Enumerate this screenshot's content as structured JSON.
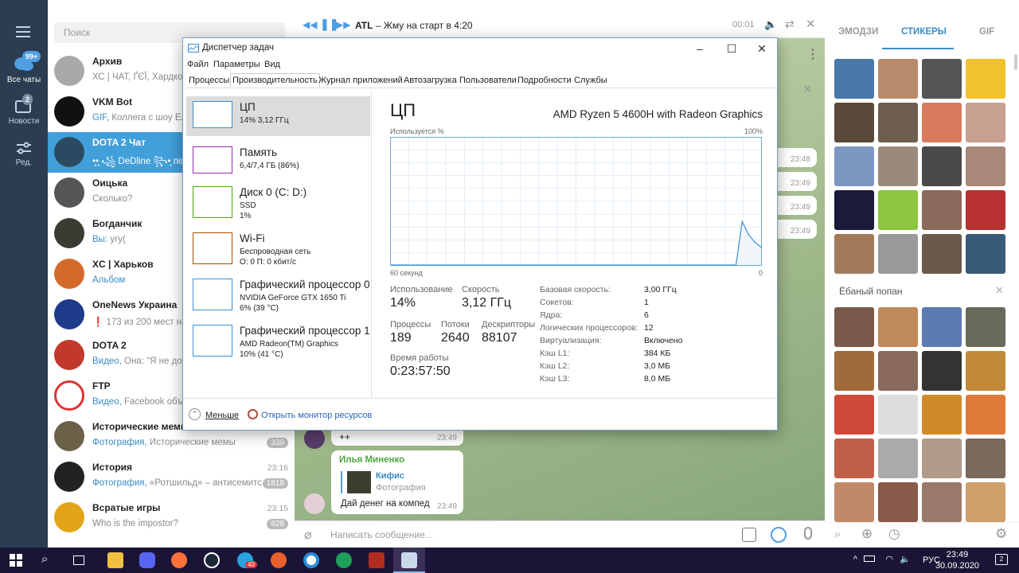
{
  "telegram": {
    "rail": [
      {
        "label": "Все чаты",
        "badge": "99+",
        "icon": "chat-bubbles-icon"
      },
      {
        "label": "Новости",
        "badge": "2",
        "icon": "folder-icon"
      },
      {
        "label": "Ред.",
        "badge": "",
        "icon": "sliders-icon"
      }
    ],
    "search_placeholder": "Поиск",
    "chats": [
      {
        "name": "Архив",
        "preview": "ХС | ЧАТ, ҐЄЇ, Хардкор...",
        "time": "",
        "badge": ""
      },
      {
        "name": "VKM Bot",
        "preview_prefix": "GIF,",
        "preview": "Коллега с шоу Еле...",
        "time": "",
        "badge": ""
      },
      {
        "name": "DOTA 2 Чат",
        "preview": "•̩̩̩͙͙•̩̩̩͙͙ ꧁ DeDline ꧂•̩̩̩͙͙ печ...",
        "time": "",
        "badge": ""
      },
      {
        "name": "Оицька",
        "preview": "Сколько?",
        "time": "",
        "badge": ""
      },
      {
        "name": "Богданчик",
        "preview_prefix": "Вы:",
        "preview": "угу(",
        "time": "",
        "badge": ""
      },
      {
        "name": "XC | Харьков",
        "preview_prefix": "Альбом",
        "preview": "",
        "time": "",
        "badge": ""
      },
      {
        "name": "OneNews Украина",
        "preview": "❗ 173 из 200 мест на...",
        "time": "",
        "badge": ""
      },
      {
        "name": "DOTA 2",
        "preview_prefix": "Видео,",
        "preview": "Она: \"Я не дого...",
        "time": "",
        "badge": ""
      },
      {
        "name": "FTP",
        "preview_prefix": "Видео,",
        "preview": "Facebook объе...",
        "time": "",
        "badge": ""
      },
      {
        "name": "Исторические мемы",
        "preview_prefix": "Фотография,",
        "preview": "Исторические мемы",
        "time": "",
        "badge": "339"
      },
      {
        "name": "История",
        "preview_prefix": "Фотография,",
        "preview": "«Ротшильд» – антисемитс...",
        "time": "23:16",
        "badge": "1818"
      },
      {
        "name": "Всратые игры",
        "preview": "Who is the impostor?",
        "time": "23:15",
        "badge": "628"
      }
    ],
    "player": {
      "artist": "ATL",
      "track": "– Жму на старт в 4:20",
      "time": "00:01"
    },
    "messages": {
      "times_right": [
        "23:48",
        "23:49",
        "23:49",
        "23:49"
      ],
      "plus": "++",
      "plus_time": "23:49",
      "sender": "Илья Миненко",
      "reply_name": "Кифис",
      "reply_type": "Фотография",
      "text": "Дай денег на компед",
      "text_time": "23:49"
    },
    "composer_placeholder": "Написать сообщение...",
    "sticker_tabs": [
      "ЭМОДЗИ",
      "СТИКЕРЫ",
      "GIF"
    ],
    "sticker_pack": "Ёбаный попан"
  },
  "taskmanager": {
    "title": "Диспетчер задач",
    "menu": [
      "Файл",
      "Параметры",
      "Вид"
    ],
    "tabs": [
      "Процессы",
      "Производительность",
      "Журнал приложений",
      "Автозагрузка",
      "Пользователи",
      "Подробности",
      "Службы"
    ],
    "resources": [
      {
        "name": "ЦП",
        "line1": "14%  3,12 ГГц",
        "line2": "",
        "color": "#3c8fd2"
      },
      {
        "name": "Память",
        "line1": "6,4/7,4 ГБ (86%)",
        "line2": "",
        "color": "#9528b4"
      },
      {
        "name": "Диск 0 (C: D:)",
        "line1": "SSD",
        "line2": "1%",
        "color": "#4da60c"
      },
      {
        "name": "Wi-Fi",
        "line1": "Беспроводная сеть",
        "line2": "О: 0  П: 0 кбит/с",
        "color": "#a74f01"
      },
      {
        "name": "Графический процессор 0",
        "line1": "NVIDIA GeForce GTX 1650 Ti",
        "line2": "6% (39 °C)",
        "color": "#3c8fd2"
      },
      {
        "name": "Графический процессор 1",
        "line1": "AMD Radeon(TM) Graphics",
        "line2": "10% (41 °C)",
        "color": "#3c8fd2"
      }
    ],
    "cpu": {
      "heading": "ЦП",
      "model": "AMD Ryzen 5 4600H with Radeon Graphics",
      "usage_caption": "Используется %",
      "max_caption": "100%",
      "axis_left": "60 секунд",
      "axis_right": "0",
      "stats": [
        {
          "label": "Использование",
          "value": "14%"
        },
        {
          "label": "Скорость",
          "value": "3,12 ГГц"
        },
        {
          "label": "Процессы",
          "value": "189"
        },
        {
          "label": "Потоки",
          "value": "2640"
        },
        {
          "label": "Дескрипторы",
          "value": "88107"
        },
        {
          "label": "Время работы",
          "value": "0:23:57:50"
        }
      ],
      "info": [
        {
          "k": "Базовая скорость:",
          "v": "3,00 ГГц"
        },
        {
          "k": "Сокетов:",
          "v": "1"
        },
        {
          "k": "Ядра:",
          "v": "6"
        },
        {
          "k": "Логических процессоров:",
          "v": "12"
        },
        {
          "k": "Виртуализация:",
          "v": "Включено"
        },
        {
          "k": "Кэш L1:",
          "v": "384 КБ"
        },
        {
          "k": "Кэш L2:",
          "v": "3,0 МБ"
        },
        {
          "k": "Кэш L3:",
          "v": "8,0 МБ"
        }
      ]
    },
    "footer": {
      "less": "Меньше",
      "monitor": "Открыть монитор ресурсов"
    }
  },
  "chart_data": {
    "type": "area",
    "ylabel": "Используется %",
    "ylim": [
      0,
      100
    ],
    "x_range_label": [
      "60 секунд",
      "0"
    ],
    "grid": true,
    "values": [
      0,
      0,
      0,
      0,
      0,
      0,
      0,
      0,
      0,
      0,
      0,
      0,
      0,
      0,
      0,
      0,
      0,
      0,
      0,
      0,
      0,
      0,
      0,
      0,
      0,
      0,
      0,
      0,
      0,
      0,
      0,
      0,
      0,
      0,
      0,
      0,
      0,
      0,
      0,
      0,
      0,
      0,
      0,
      0,
      0,
      0,
      0,
      0,
      0,
      0,
      0,
      0,
      0,
      0,
      0,
      0,
      34,
      24,
      18,
      14
    ]
  },
  "taskbar": {
    "lang": "РУС",
    "time": "23:49",
    "date": "30.09.2020",
    "notifications": "2",
    "telegram_badge": "40"
  }
}
